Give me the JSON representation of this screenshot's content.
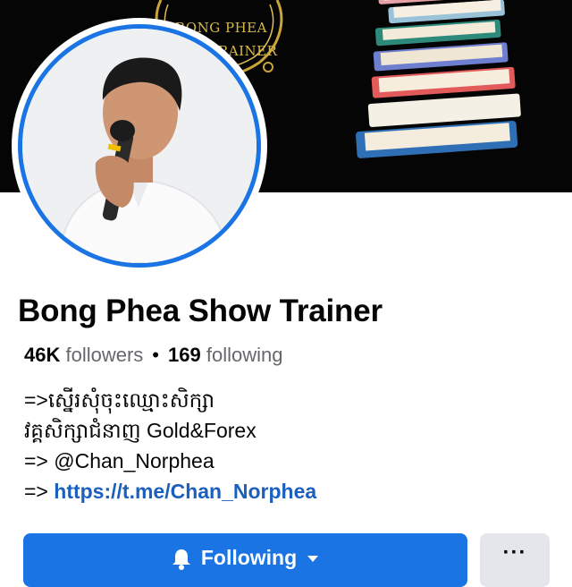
{
  "cover": {
    "emblem_line1": "BONG PHEA",
    "emblem_line2": "RAINER"
  },
  "profile": {
    "name": "Bong Phea Show Trainer",
    "followers_count": "46K",
    "followers_label": "followers",
    "separator": "•",
    "following_count": "169",
    "following_label": "following"
  },
  "bio": {
    "line1": "=>ស្នើរសុំចុះឈ្មោះសិក្សា",
    "line2": "វគ្គសិក្សាជំនាញ Gold&Forex",
    "line3": "=> @Chan_Norphea",
    "line4_prefix": "=> ",
    "line4_link": "https://t.me/Chan_Norphea"
  },
  "actions": {
    "following_label": "Following",
    "more_label": "···"
  },
  "colors": {
    "accent": "#1b74e4",
    "link": "#1b5fbf",
    "muted": "#65676b",
    "secondary_button": "#e4e6eb"
  },
  "icons": {
    "following_icon": "bell-icon",
    "following_dropdown": "caret-down-icon",
    "more": "ellipsis-icon"
  }
}
